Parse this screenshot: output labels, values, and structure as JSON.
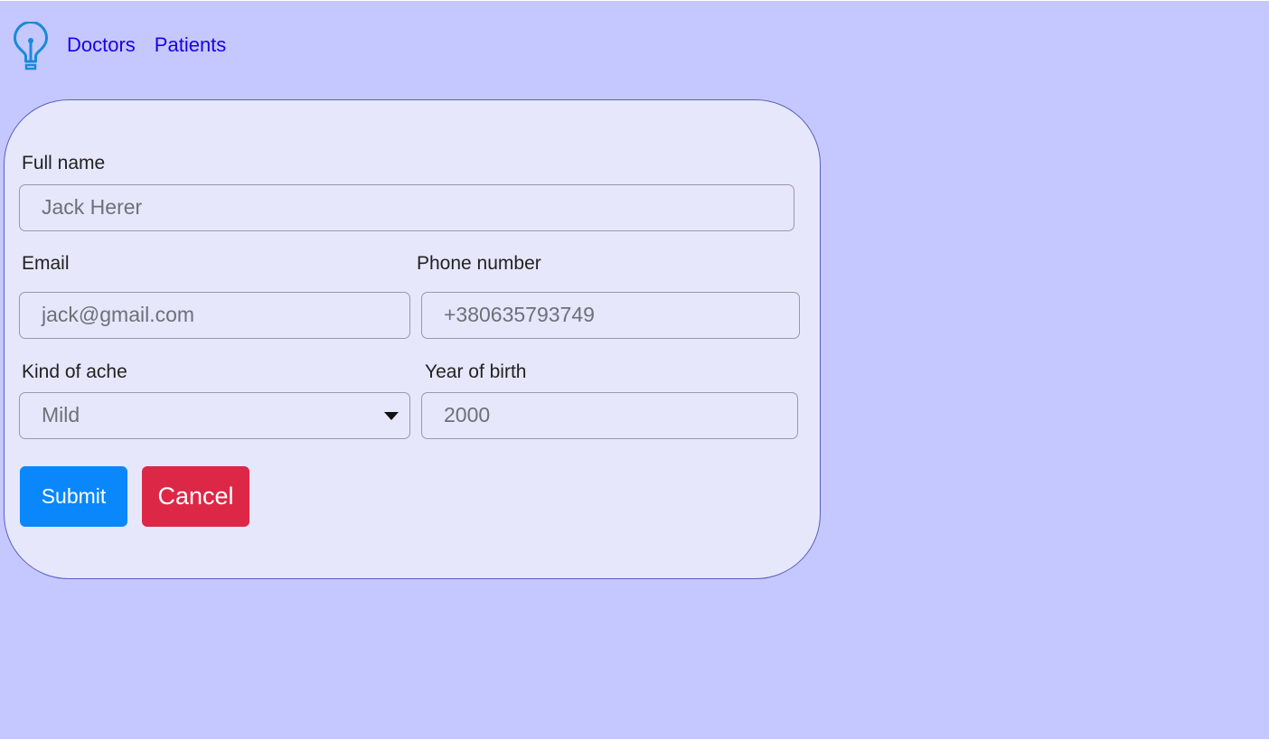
{
  "nav": {
    "logo_icon": "lightbulb-icon",
    "links": [
      {
        "label": "Doctors"
      },
      {
        "label": "Patients"
      }
    ]
  },
  "form": {
    "full_name": {
      "label": "Full name",
      "placeholder": "Jack Herer"
    },
    "email": {
      "label": "Email",
      "placeholder": "jack@gmail.com"
    },
    "phone": {
      "label": "Phone number",
      "placeholder": "+380635793749"
    },
    "ache": {
      "label": "Kind of ache",
      "value": "Mild"
    },
    "birth_year": {
      "label": "Year of birth",
      "placeholder": "2000"
    },
    "submit_label": "Submit",
    "cancel_label": "Cancel"
  },
  "colors": {
    "page_background": "#c5c7ff",
    "card_background": "#e6e7fb",
    "card_border": "#5a5fc0",
    "link": "#1b00e6",
    "logo": "#1a8ad8",
    "submit": "#0a87fb",
    "cancel": "#dc2846"
  }
}
